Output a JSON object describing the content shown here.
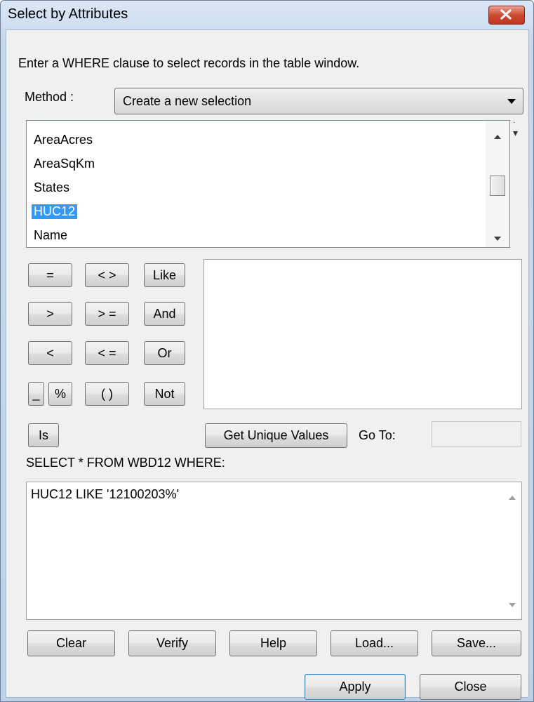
{
  "window": {
    "title": "Select by Attributes"
  },
  "instruction": "Enter a WHERE clause to select records in the table window.",
  "method": {
    "label": "Method :",
    "value": "Create a new selection"
  },
  "fields": {
    "items": [
      "AreaAcres",
      "AreaSqKm",
      "States",
      "HUC12",
      "Name"
    ],
    "selected": "HUC12"
  },
  "operators": {
    "equals": "=",
    "not_equal": "< >",
    "like": "Like",
    "greater": ">",
    "greater_equal": "> =",
    "and": "And",
    "less": "<",
    "less_equal": "< =",
    "or": "Or",
    "underscore": "_",
    "percent": "%",
    "parens": "( )",
    "not": "Not",
    "is": "Is"
  },
  "unique_values": {
    "button": "Get Unique Values",
    "goto_label": "Go To:",
    "goto_value": ""
  },
  "query": {
    "label": "SELECT * FROM WBD12 WHERE:",
    "expression": "HUC12 LIKE '12100203%'"
  },
  "actions": {
    "clear": "Clear",
    "verify": "Verify",
    "help": "Help",
    "load": "Load...",
    "save": "Save..."
  },
  "footer": {
    "apply": "Apply",
    "close": "Close"
  },
  "colors": {
    "selection": "#3399ff",
    "close_button": "#c7432d",
    "default_button_border": "#3c7fb1"
  }
}
